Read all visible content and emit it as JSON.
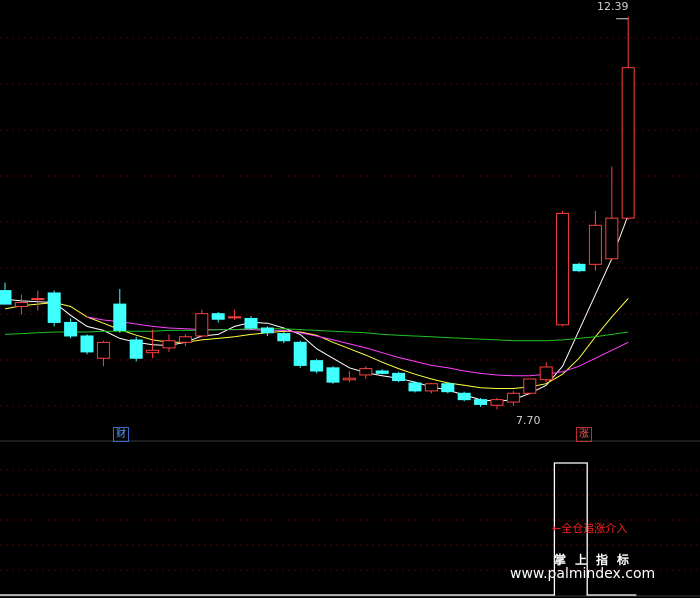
{
  "chart_data": {
    "type": "candlestick",
    "price_high_label": "12.39",
    "price_low_label": "7.70",
    "price_axis": {
      "max": 12.55,
      "min": 7.45
    },
    "candles": [
      {
        "o": 8.95,
        "h": 9.05,
        "l": 8.8,
        "c": 8.78
      },
      {
        "o": 8.75,
        "h": 8.9,
        "l": 8.65,
        "c": 8.8
      },
      {
        "o": 8.85,
        "h": 8.95,
        "l": 8.7,
        "c": 8.85
      },
      {
        "o": 8.92,
        "h": 8.95,
        "l": 8.5,
        "c": 8.55
      },
      {
        "o": 8.55,
        "h": 8.6,
        "l": 8.35,
        "c": 8.38
      },
      {
        "o": 8.38,
        "h": 8.4,
        "l": 8.15,
        "c": 8.18
      },
      {
        "o": 8.1,
        "h": 8.32,
        "l": 8.0,
        "c": 8.3
      },
      {
        "o": 8.78,
        "h": 8.97,
        "l": 8.42,
        "c": 8.45
      },
      {
        "o": 8.33,
        "h": 8.37,
        "l": 8.06,
        "c": 8.1
      },
      {
        "o": 8.17,
        "h": 8.46,
        "l": 8.1,
        "c": 8.2
      },
      {
        "o": 8.23,
        "h": 8.4,
        "l": 8.18,
        "c": 8.32
      },
      {
        "o": 8.3,
        "h": 8.4,
        "l": 8.25,
        "c": 8.37
      },
      {
        "o": 8.38,
        "h": 8.71,
        "l": 8.36,
        "c": 8.66
      },
      {
        "o": 8.66,
        "h": 8.68,
        "l": 8.55,
        "c": 8.59
      },
      {
        "o": 8.61,
        "h": 8.71,
        "l": 8.58,
        "c": 8.62
      },
      {
        "o": 8.6,
        "h": 8.63,
        "l": 8.46,
        "c": 8.48
      },
      {
        "o": 8.48,
        "h": 8.5,
        "l": 8.38,
        "c": 8.42
      },
      {
        "o": 8.41,
        "h": 8.43,
        "l": 8.29,
        "c": 8.32
      },
      {
        "o": 8.3,
        "h": 8.32,
        "l": 7.98,
        "c": 8.01
      },
      {
        "o": 8.07,
        "h": 8.09,
        "l": 7.91,
        "c": 7.94
      },
      {
        "o": 7.98,
        "h": 8.0,
        "l": 7.78,
        "c": 7.8
      },
      {
        "o": 7.83,
        "h": 7.94,
        "l": 7.8,
        "c": 7.85
      },
      {
        "o": 7.89,
        "h": 8.0,
        "l": 7.84,
        "c": 7.97
      },
      {
        "o": 7.94,
        "h": 7.96,
        "l": 7.9,
        "c": 7.91
      },
      {
        "o": 7.91,
        "h": 7.93,
        "l": 7.8,
        "c": 7.82
      },
      {
        "o": 7.79,
        "h": 7.81,
        "l": 7.67,
        "c": 7.69
      },
      {
        "o": 7.69,
        "h": 7.79,
        "l": 7.66,
        "c": 7.78
      },
      {
        "o": 7.78,
        "h": 7.8,
        "l": 7.66,
        "c": 7.68
      },
      {
        "o": 7.66,
        "h": 7.68,
        "l": 7.56,
        "c": 7.58
      },
      {
        "o": 7.58,
        "h": 7.6,
        "l": 7.49,
        "c": 7.52
      },
      {
        "o": 7.51,
        "h": 7.6,
        "l": 7.46,
        "c": 7.58
      },
      {
        "o": 7.55,
        "h": 7.69,
        "l": 7.5,
        "c": 7.66
      },
      {
        "o": 7.66,
        "h": 7.84,
        "l": 7.64,
        "c": 7.84
      },
      {
        "o": 7.83,
        "h": 8.05,
        "l": 7.8,
        "c": 7.99
      },
      {
        "o": 8.52,
        "h": 9.95,
        "l": 8.5,
        "c": 9.92
      },
      {
        "o": 9.28,
        "h": 9.3,
        "l": 9.18,
        "c": 9.2
      },
      {
        "o": 9.28,
        "h": 9.95,
        "l": 9.2,
        "c": 9.77
      },
      {
        "o": 9.35,
        "h": 10.51,
        "l": 9.33,
        "c": 9.86
      },
      {
        "o": 9.86,
        "h": 12.39,
        "l": 9.84,
        "c": 11.75
      }
    ],
    "series": [
      {
        "color": "#ffffff",
        "values": [
          8.84,
          8.82,
          8.81,
          8.8,
          8.64,
          8.5,
          8.45,
          8.35,
          8.3,
          8.27,
          8.26,
          8.3,
          8.38,
          8.4,
          8.5,
          8.55,
          8.54,
          8.48,
          8.4,
          8.22,
          8.1,
          7.98,
          7.92,
          7.88,
          7.85,
          7.8,
          7.74,
          7.7,
          7.64,
          7.58,
          7.56,
          7.58,
          7.66,
          7.76,
          8.0,
          8.45,
          8.9,
          9.35,
          9.9
        ]
      },
      {
        "color": "#ffff40",
        "values": [
          8.72,
          8.76,
          8.78,
          8.8,
          8.75,
          8.62,
          8.54,
          8.46,
          8.39,
          8.33,
          8.3,
          8.3,
          8.33,
          8.35,
          8.37,
          8.4,
          8.42,
          8.44,
          8.43,
          8.39,
          8.3,
          8.22,
          8.14,
          8.05,
          7.97,
          7.9,
          7.84,
          7.79,
          7.76,
          7.73,
          7.72,
          7.72,
          7.74,
          7.78,
          7.9,
          8.1,
          8.37,
          8.62,
          8.85
        ]
      },
      {
        "color": "#ff40ff",
        "values": [
          null,
          null,
          null,
          null,
          null,
          8.62,
          8.58,
          8.56,
          8.53,
          8.5,
          8.48,
          8.47,
          8.46,
          8.46,
          8.46,
          8.46,
          8.45,
          8.45,
          8.42,
          8.38,
          8.33,
          8.28,
          8.23,
          8.17,
          8.11,
          8.06,
          8.01,
          7.98,
          7.94,
          7.91,
          7.89,
          7.88,
          7.88,
          7.9,
          7.93,
          8.0,
          8.1,
          8.2,
          8.3
        ]
      },
      {
        "color": "#20c020",
        "values": [
          8.4,
          8.41,
          8.42,
          8.43,
          8.43,
          8.43,
          8.44,
          8.44,
          8.44,
          8.44,
          8.45,
          8.45,
          8.45,
          8.46,
          8.46,
          8.47,
          8.47,
          8.47,
          8.46,
          8.45,
          8.44,
          8.43,
          8.42,
          8.4,
          8.39,
          8.38,
          8.37,
          8.36,
          8.35,
          8.34,
          8.33,
          8.32,
          8.32,
          8.32,
          8.33,
          8.35,
          8.37,
          8.4,
          8.43
        ]
      }
    ],
    "signals": {
      "cai_label": "财",
      "cai_index": 3,
      "zhang_label": "涨",
      "zhang_index": 34
    },
    "indicator": {
      "signal_text": "←全仓追涨介入",
      "values": [
        0,
        0,
        0,
        0,
        0,
        0,
        0,
        0,
        0,
        0,
        0,
        0,
        0,
        0,
        0,
        0,
        0,
        0,
        0,
        0,
        0,
        0,
        0,
        0,
        0,
        0,
        0,
        0,
        0,
        0,
        0,
        0,
        0,
        0,
        1,
        1,
        0,
        0,
        0
      ],
      "line_color": "#ffffff"
    },
    "colors": {
      "up": "#ff4040",
      "down": "#40ffff",
      "grid": "#5a0000",
      "separator": "#3a3a3a"
    }
  },
  "watermark": {
    "cn": "掌上指标",
    "url": "www.palmindex.com"
  }
}
